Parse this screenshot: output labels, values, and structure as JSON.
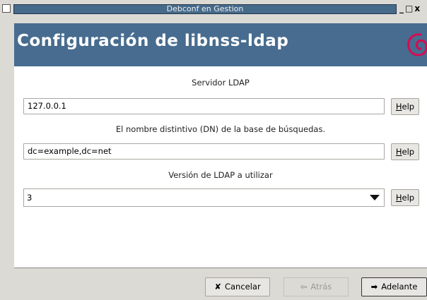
{
  "window": {
    "title": "Debconf en Gestion",
    "controls": [
      "_",
      "□",
      "x"
    ]
  },
  "header": {
    "title": "Configuración de libnss-ldap",
    "logo": "debian-swirl-icon",
    "logo_color": "#d70a53"
  },
  "form": {
    "server_label": "Servidor LDAP",
    "server_value": "127.0.0.1",
    "dn_label": "El nombre distintivo (DN) de la base de búsquedas.",
    "dn_value": "dc=example,dc=net",
    "version_label": "Versión de LDAP a utilizar",
    "version_value": "3",
    "help_label": "Help"
  },
  "buttons": {
    "cancel": "Cancelar",
    "back": "Atrás",
    "next": "Adelante"
  },
  "colors": {
    "header_bg": "#476c8f",
    "title_bar_bg": "#466a8a",
    "window_bg": "#dcdad5"
  }
}
